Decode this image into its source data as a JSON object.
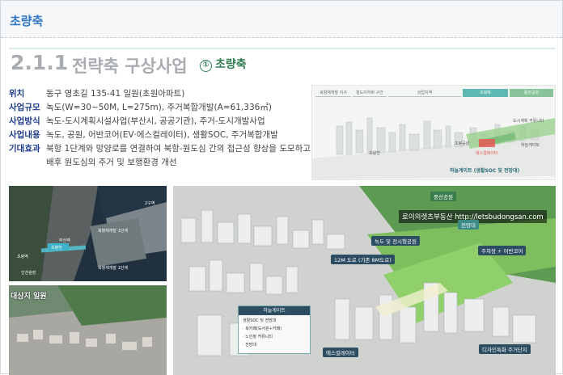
{
  "header": {
    "title": "초량축"
  },
  "section": {
    "number": "2.1.1",
    "title": "전략축 구상사업",
    "sub_num": "①",
    "sub_title": "초량축"
  },
  "info": {
    "rows": [
      {
        "label": "위치",
        "value": "동구 영초길 135-41 일원(초원아파트)"
      },
      {
        "label": "사업규모",
        "value": "녹도(W=30~50M, L=275m), 주거복합개발(A=61,336㎡)"
      },
      {
        "label": "사업방식",
        "value": "녹도-도시계획시설사업(부산시, 공공기관), 주거-도시개발사업"
      },
      {
        "label": "사업내용",
        "value": "녹도, 공원, 어반코어(EV·에스컬레이터), 생활SOC, 주거복합개발"
      },
      {
        "label": "기대효과",
        "value": "북항 1단계와 망양로를 연결하여 북항-원도심 간의 접근성 향상을 도모하고"
      },
      {
        "label": "",
        "value": "배후 원도심의 주거 및 보행환경 개선"
      }
    ]
  },
  "diagram": {
    "tabs": [
      "북항재개발 지구",
      "철도지하화 구간",
      "상업지역",
      "초량축",
      "증산공원"
    ],
    "notes": [
      "초량천",
      "에스컬레이터",
      "도시계획 커뮤니티",
      "하늘게이트",
      "초량공원"
    ],
    "caption": "하늘게이트 (생활SOC 및 전망대)"
  },
  "satellite": {
    "labels": [
      "2구역",
      "북항재개발 1단계",
      "부산역",
      "초량천",
      "초량역",
      "북항재개발 1단계",
      "인천광장"
    ],
    "bottom_label": "대상지 일원"
  },
  "render": {
    "url": "로이의렛츠부동산 http://letsbudongsan.com",
    "tags": [
      "중산공원",
      "전망대",
      "녹도 및 전시형공원",
      "12M 도로 (기존 8M도로)",
      "주차장 + 어반코어",
      "디자인특화 주거단지",
      "에스컬레이터"
    ],
    "sky": {
      "title": "하늘게이트",
      "lines": [
        "생활SOC 및 전망대",
        "· 북카페(도서관+카페)",
        "· 노인정 커뮤니티",
        "· 전망대"
      ]
    }
  },
  "colors": {
    "accent": "#2f76c6",
    "label": "#1d3c8a",
    "green": "#2f7d53"
  }
}
